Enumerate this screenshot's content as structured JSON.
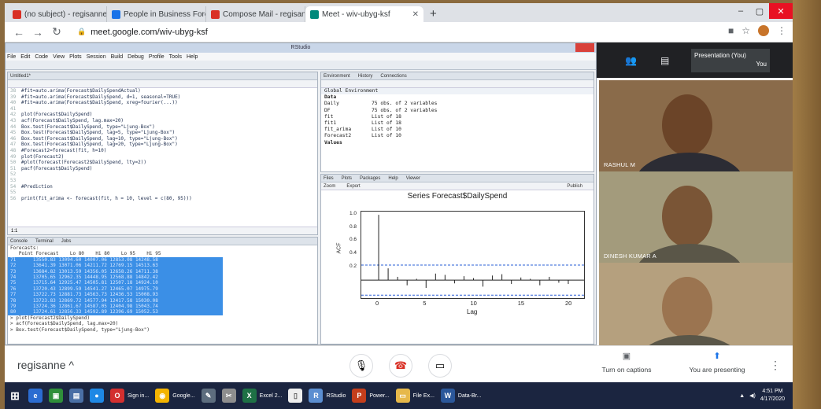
{
  "browser": {
    "tabs": [
      {
        "label": "(no subject) - regisanne@skcet.ac.in",
        "color": "#d93025"
      },
      {
        "label": "People in Business Forecasting",
        "color": "#1a73e8"
      },
      {
        "label": "Compose Mail - regisanne@skcet",
        "color": "#d93025"
      },
      {
        "label": "Meet - wiv-ubyg-ksf",
        "color": "#00897b",
        "active": true
      }
    ],
    "new_tab": "+",
    "url": "meet.google.com/wiv-ubyg-ksf"
  },
  "rstudio": {
    "title": "RStudio",
    "menu": [
      "File",
      "Edit",
      "Code",
      "View",
      "Plots",
      "Session",
      "Build",
      "Debug",
      "Profile",
      "Tools",
      "Help"
    ],
    "source_tab": "Untitled1*",
    "code": [
      {
        "n": "38",
        "t": "#fit=auto.arima(Forecast$DailySpendActual)"
      },
      {
        "n": "39",
        "t": "#fit=auto.arima(Forecast$DailySpend, d=1, seasonal=TRUE)"
      },
      {
        "n": "40",
        "t": "#fit=auto.arima(Forecast$DailySpend, xreg=fourier(...))"
      },
      {
        "n": "41",
        "t": ""
      },
      {
        "n": "42",
        "t": "plot(Forecast$DailySpend)"
      },
      {
        "n": "43",
        "t": "acf(Forecast$DailySpend, lag.max=20)"
      },
      {
        "n": "44",
        "t": "Box.test(Forecast$DailySpend, type=\"Ljung-Box\")"
      },
      {
        "n": "45",
        "t": "Box.test(Forecast$DailySpend, lag=5, type=\"Ljung-Box\")"
      },
      {
        "n": "46",
        "t": "Box.test(Forecast$DailySpend, lag=10, type=\"Ljung-Box\")"
      },
      {
        "n": "47",
        "t": "Box.test(Forecast$DailySpend, lag=20, type=\"Ljung-Box\")"
      },
      {
        "n": "48",
        "t": "#Forecast2=forecast(fit, h=10)"
      },
      {
        "n": "49",
        "t": "plot(Forecast2)"
      },
      {
        "n": "50",
        "t": "#plot(forecast(Forecast2$DailySpend, lty=2))"
      },
      {
        "n": "51",
        "t": "pacf(Forecast$DailySpend)"
      },
      {
        "n": "52",
        "t": ""
      },
      {
        "n": "53",
        "t": ""
      },
      {
        "n": "54",
        "t": "#Prediction"
      },
      {
        "n": "55",
        "t": ""
      },
      {
        "n": "56",
        "t": "print(fit_arima <- forecast(fit, h = 10, level = c(80, 95)))"
      }
    ],
    "source_status": "1:1",
    "console_tabs": [
      "Console",
      "Terminal",
      "Jobs"
    ],
    "console_lines": [
      "Forecasts:",
      "   Point Forecast    Lo 80    Hi 80    Lo 95    Hi 95"
    ],
    "console_selected": [
      "71      13550.83 13094.60 14007.06 12853.08 14248.58",
      "72      13641.39 13071.06 14211.72 12769.15 14513.63",
      "73      13684.82 13013.59 14356.05 12658.26 14711.38",
      "74      13705.65 12962.35 14448.95 12568.88 14842.42",
      "75      13715.64 12925.47 14505.81 12507.18 14924.10",
      "76      13720.43 12899.59 14541.27 12465.07 14975.79",
      "77      13722.73 12881.73 14563.73 12436.53 15008.93",
      "78      13723.83 12869.72 14577.94 12417.58 15030.08",
      "79      13724.36 12861.67 14587.05 12404.98 15043.74",
      "80      13724.61 12856.33 14592.89 12396.69 15052.53"
    ],
    "console_tail": [
      "> plot(Forecast2$DailySpend)",
      "> acf(Forecast$DailySpend, lag.max=20)",
      "> Box.test(Forecast$DailySpend, type=\"Ljung-Box\")"
    ],
    "env_tabs": [
      "Environment",
      "History",
      "Connections"
    ],
    "env_scope": "Global Environment",
    "env_section": "Data",
    "env_rows": [
      {
        "name": "Daily",
        "value": "75 obs. of 2 variables"
      },
      {
        "name": "DF",
        "value": "75 obs. of 2 variables"
      },
      {
        "name": "fit",
        "value": "List of 18"
      },
      {
        "name": "fit1",
        "value": "List of 18"
      },
      {
        "name": "fit_arima",
        "value": "List of 10"
      },
      {
        "name": "Forecast2",
        "value": "List of 10"
      }
    ],
    "env_section2": "Values",
    "plot_tabs": [
      "Files",
      "Plots",
      "Packages",
      "Help",
      "Viewer"
    ],
    "plot_tools": [
      "Zoom",
      "Export"
    ],
    "plot_publish": "Publish",
    "plot_title": "Series  Forecast$DailySpend"
  },
  "chart_data": {
    "type": "bar",
    "title": "Series  Forecast$DailySpend",
    "xlabel": "Lag",
    "ylabel": "ACF",
    "x": [
      0,
      1,
      2,
      3,
      4,
      5,
      6,
      7,
      8,
      9,
      10,
      11,
      12,
      13,
      14,
      15,
      16,
      17,
      18,
      19,
      20
    ],
    "values": [
      1.0,
      0.18,
      0.05,
      -0.08,
      0.02,
      -0.12,
      0.1,
      0.08,
      -0.05,
      0.06,
      0.03,
      -0.1,
      0.07,
      0.09,
      -0.06,
      0.04,
      0.02,
      -0.08,
      0.05,
      -0.04,
      -0.06
    ],
    "xticks": [
      0,
      5,
      10,
      15,
      20
    ],
    "yticks": [
      0.2,
      0.4,
      0.6,
      0.8,
      1.0
    ],
    "ylim": [
      -0.3,
      1.05
    ],
    "confidence": 0.23
  },
  "participants": {
    "presentation": "Presentation (You)",
    "you": "You",
    "tiles": [
      {
        "name": "RASHUL M",
        "bg": "#8a6b4a",
        "skin": "#6b4428"
      },
      {
        "name": "DINESH KUMAR A",
        "bg": "#a39b7c",
        "skin": "#7a5536"
      },
      {
        "name": "",
        "bg": "#b5a07e",
        "skin": "#9b7450"
      }
    ]
  },
  "meet": {
    "user": "regisanne",
    "captions": "Turn on captions",
    "presenting": "You are presenting"
  },
  "taskbar": {
    "items": [
      {
        "label": "",
        "color": "#2b6cd1",
        "glyph": "e"
      },
      {
        "label": "",
        "color": "#2f8f3a",
        "glyph": "▣"
      },
      {
        "label": "",
        "color": "#4a6fa5",
        "glyph": "▤"
      },
      {
        "label": "",
        "color": "#1e88e5",
        "glyph": "●"
      },
      {
        "label": "Sign in...",
        "color": "#d32f2f",
        "glyph": "O"
      },
      {
        "label": "Google...",
        "color": "#f4b400",
        "glyph": "◉"
      },
      {
        "label": "",
        "color": "#5d6d7e",
        "glyph": "✎"
      },
      {
        "label": "",
        "color": "#8e8e8e",
        "glyph": "✂"
      },
      {
        "label": "Excel 2...",
        "color": "#1e7145",
        "glyph": "X"
      },
      {
        "label": "",
        "color": "#eeeeee",
        "glyph": "▯"
      },
      {
        "label": "RStudio",
        "color": "#5b8ed1",
        "glyph": "R"
      },
      {
        "label": "Power...",
        "color": "#c43e1c",
        "glyph": "P"
      },
      {
        "label": "File Ex...",
        "color": "#e6b84a",
        "glyph": "▭"
      },
      {
        "label": "Data-Br...",
        "color": "#2b579a",
        "glyph": "W"
      }
    ],
    "time": "4:51 PM",
    "date": "4/17/2020"
  }
}
